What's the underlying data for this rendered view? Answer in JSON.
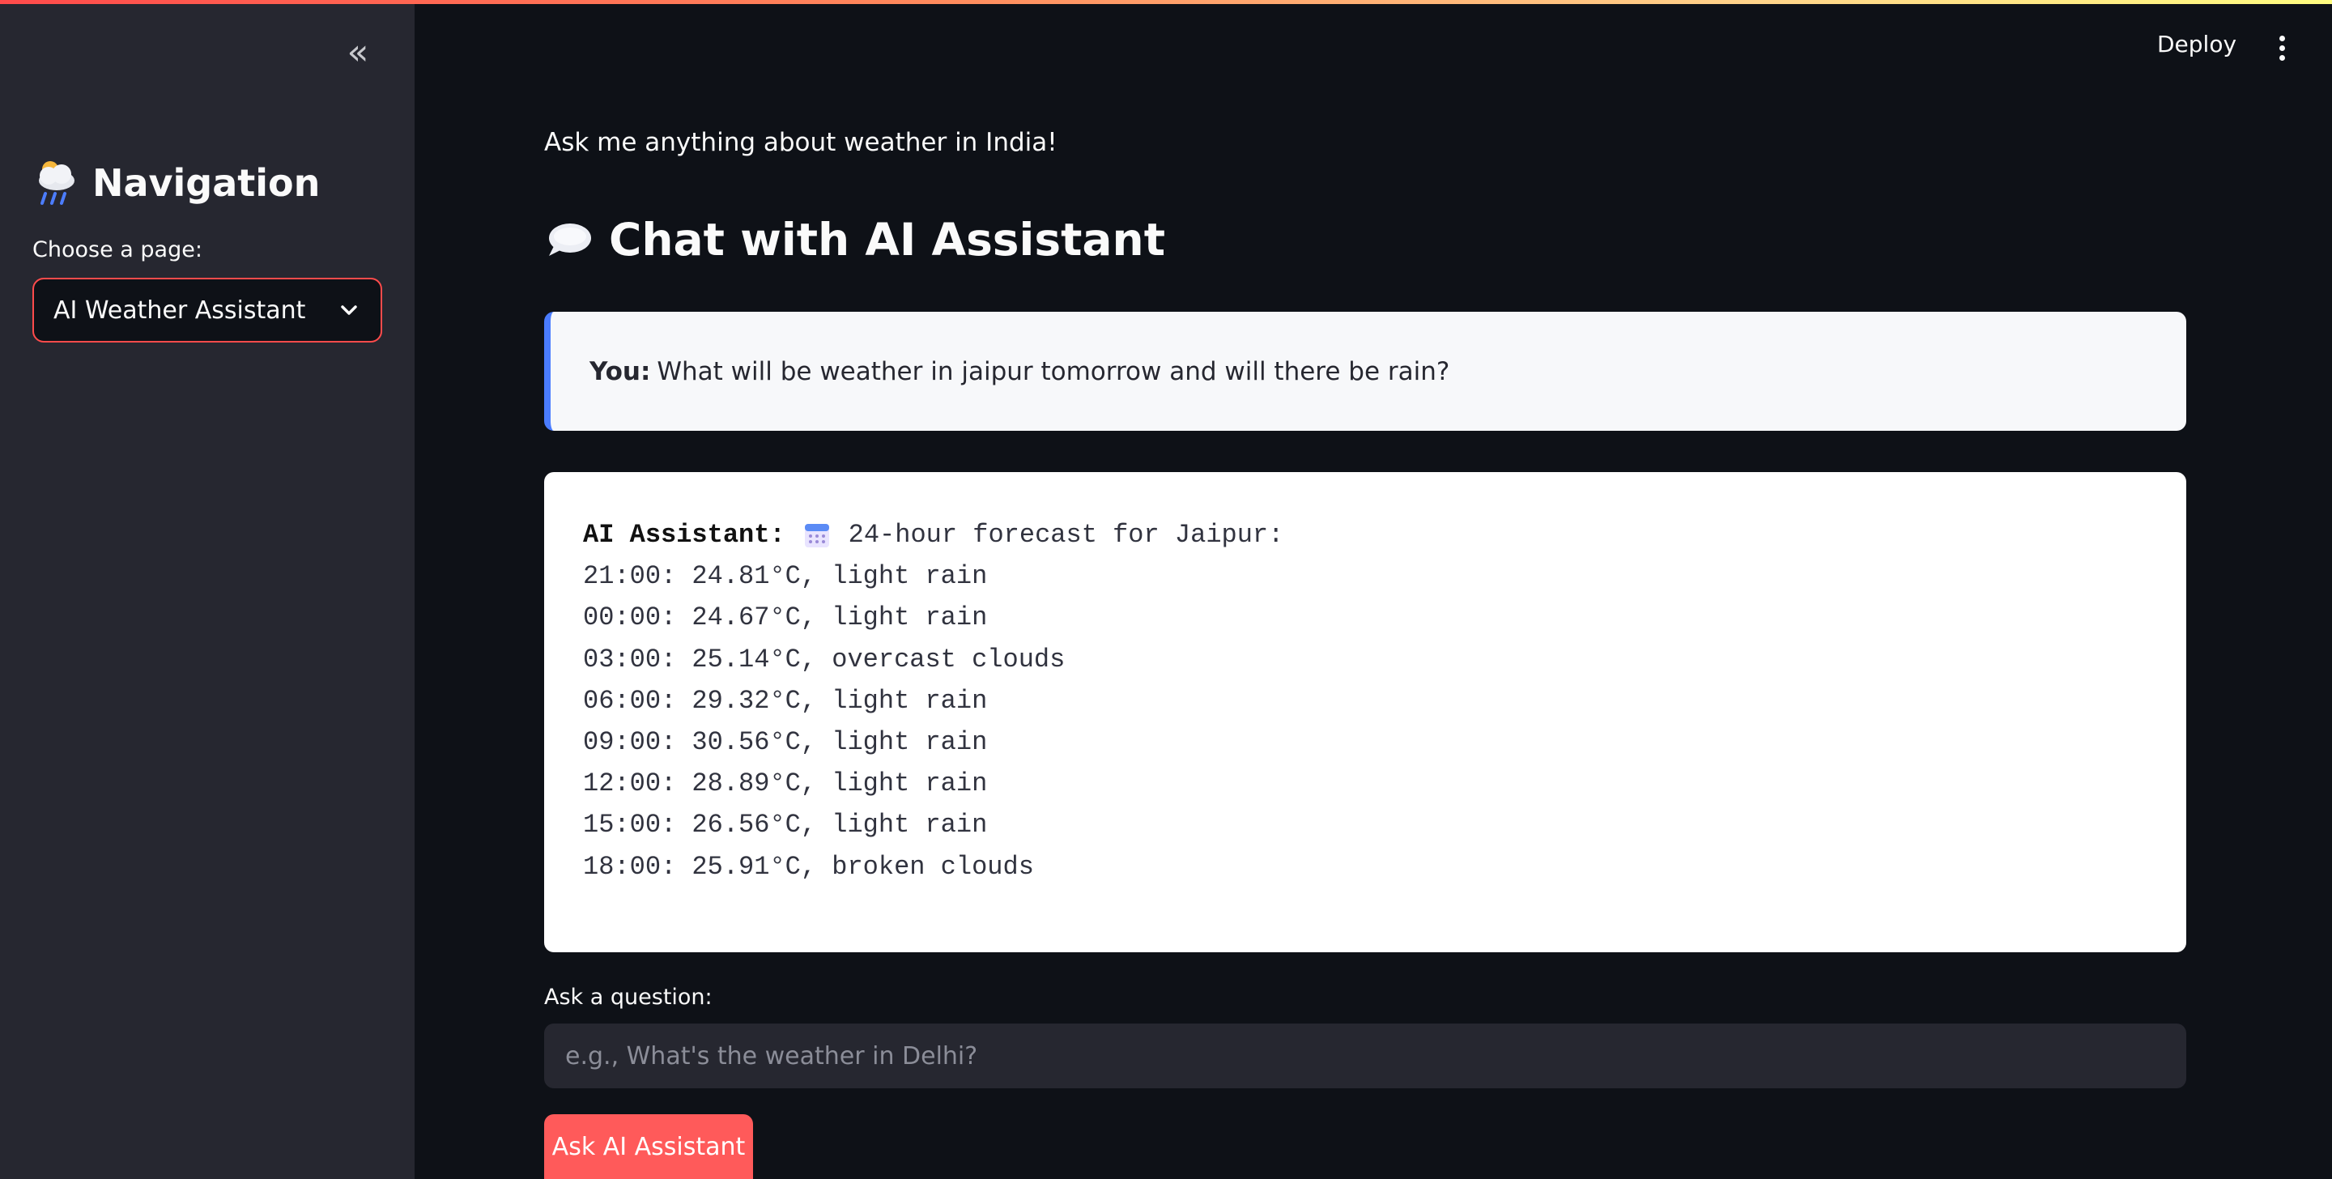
{
  "sidebar": {
    "collapse_icon": "double-chevron-left-icon",
    "heading": "Navigation",
    "heading_icon": "cloud-rain-icon",
    "select_label": "Choose a page:",
    "select_value": "AI Weather Assistant",
    "select_icon": "chevron-down-icon"
  },
  "header": {
    "deploy_label": "Deploy",
    "menu_icon": "kebab-menu-icon"
  },
  "main": {
    "intro": "Ask me anything about weather in India!",
    "chat_heading": "Chat with AI Assistant",
    "chat_heading_icon": "speech-bubble-icon",
    "user_message": {
      "sender": "You:",
      "text": "What will be weather in jaipur tomorrow and will there be rain?"
    },
    "ai_message": {
      "sender": "AI Assistant:",
      "icon": "calendar-icon",
      "title": "24-hour forecast for Jaipur:",
      "lines": [
        "21:00: 24.81°C, light rain",
        "00:00: 24.67°C, light rain",
        "03:00: 25.14°C, overcast clouds",
        "06:00: 29.32°C, light rain",
        "09:00: 30.56°C, light rain",
        "12:00: 28.89°C, light rain",
        "15:00: 26.56°C, light rain",
        "18:00: 25.91°C, broken clouds"
      ]
    },
    "question_label": "Ask a question:",
    "question_placeholder": "e.g., What's the weather in Delhi?",
    "question_value": "",
    "submit_label": "Ask AI Assistant"
  },
  "colors": {
    "background": "#0e1117",
    "sidebar": "#262730",
    "accent": "#ff4b4b",
    "user_border": "#4a7cff"
  }
}
